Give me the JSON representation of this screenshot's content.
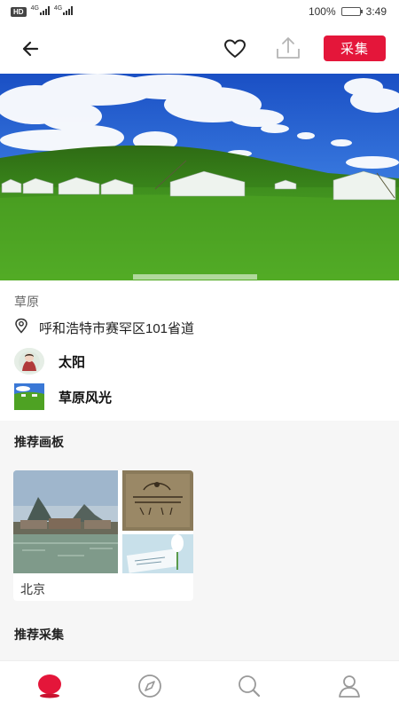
{
  "status_bar": {
    "badge": "HD",
    "net_1": "4G",
    "net_2": "4G",
    "battery_percent": "100%",
    "battery_level": 1.0,
    "time": "3:49"
  },
  "header": {
    "back_icon": "back-arrow-icon",
    "favorite_icon": "heart-icon",
    "share_icon": "upload-share-icon",
    "collect_label": "采集",
    "accent_color": "#e4163a"
  },
  "pin": {
    "title": "草原",
    "location": "呼和浩特市赛罕区101省道",
    "user_name": "太阳",
    "board_name": "草原风光"
  },
  "recommended_boards": {
    "title": "推荐画板",
    "items": [
      {
        "label": "北京"
      }
    ]
  },
  "recommended_collections": {
    "title": "推荐采集"
  },
  "bottom_nav": {
    "items": [
      {
        "icon": "home-dot-icon",
        "active": true
      },
      {
        "icon": "discover-compass-icon",
        "active": false
      },
      {
        "icon": "search-icon",
        "active": false
      },
      {
        "icon": "profile-icon",
        "active": false
      }
    ]
  }
}
